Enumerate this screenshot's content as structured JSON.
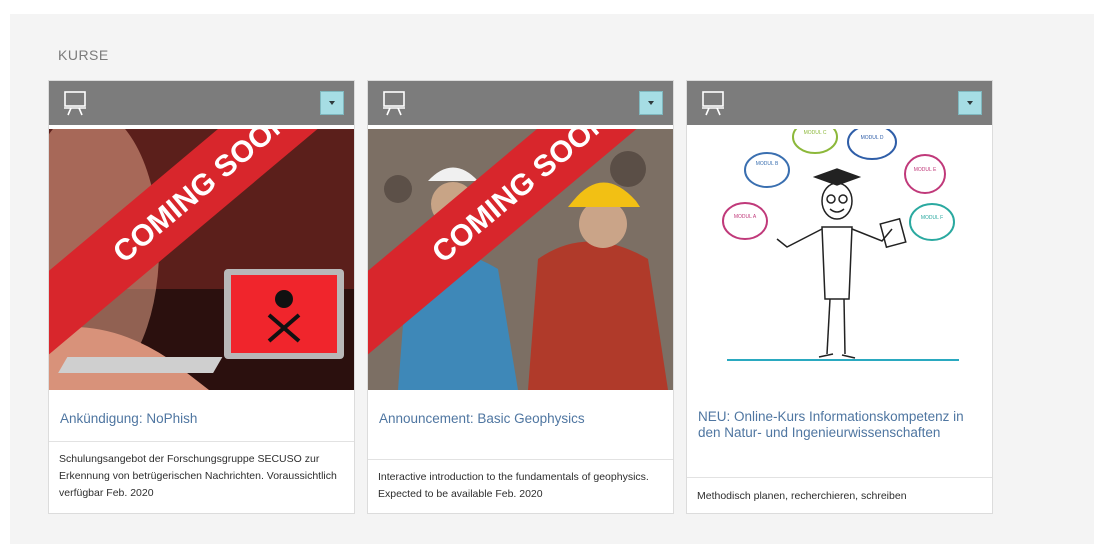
{
  "section": {
    "title": "KURSE"
  },
  "cards": [
    {
      "banner": "COMING SOON",
      "title": "Ankündigung: NoPhish",
      "description": "Schulungsangebot der Forschungsgruppe SECUSO zur Erkennung von betrügerischen Nachrichten. Voraussichtlich verfügbar Feb. 2020"
    },
    {
      "banner": "COMING SOON",
      "title": "Announcement: Basic Geophysics",
      "description": "Interactive introduction to the fundamentals of geophysics. Expected to be available Feb. 2020"
    },
    {
      "title": "NEU: Online-Kurs Informationskompetenz in den Natur- und Ingenieurwissenschaften",
      "description": "Methodisch planen, recherchieren, schreiben",
      "modules": [
        "MODUL A",
        "MODUL B",
        "MODUL C",
        "MODUL D",
        "MODUL E",
        "MODUL F"
      ]
    }
  ],
  "colors": {
    "header": "#7c7c7c",
    "menu_button": "#a6dde4",
    "link": "#4f76a1",
    "banner": "#d8262c"
  },
  "icons": {
    "course": "presentation-board-icon",
    "menu": "caret-down-icon"
  }
}
